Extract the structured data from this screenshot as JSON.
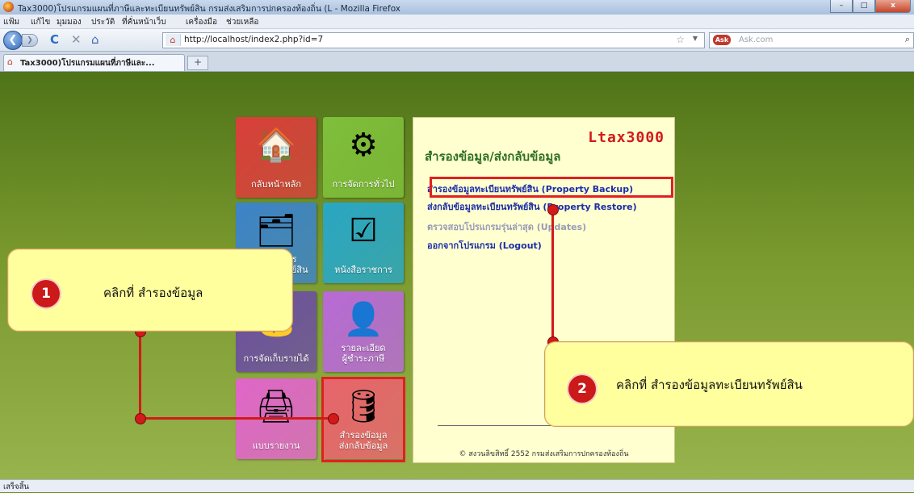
{
  "window": {
    "title": "Tax3000)โปรแกรมแผนที่ภาษีและทะเบียนทรัพย์สิน กรมส่งเสริมการปกครองท้องถิ่น (L - Mozilla Firefox",
    "minimize": "–",
    "maximize": "□",
    "close": "x"
  },
  "menubar": [
    "แฟ้ม",
    "แก้ไข",
    "มุมมอง",
    "ประวัติ",
    "ที่คั่นหน้าเว็บ",
    "เครื่องมือ",
    "ช่วยเหลือ"
  ],
  "nav": {
    "url": "http://localhost/index2.php?id=7",
    "search_placeholder": "Ask.com",
    "search_engine": "Ask",
    "reload": "C",
    "stop": "✕",
    "home": "⌂"
  },
  "tabs": [
    {
      "label": "Tax3000)โปรแกรมแผนที่ภาษีและ..."
    }
  ],
  "new_tab": "+",
  "tiles": [
    {
      "label": "กลับหน้าหลัก",
      "icon": "house-icon",
      "glyph": "🏠",
      "color": "#d9403a"
    },
    {
      "label": "การจัดการทั่วไป",
      "icon": "gear-pencil-icon",
      "glyph": "⚙",
      "color": "#7fbf3a"
    },
    {
      "label": "การจัดการ\nทะเบียนทรัพย์สิน",
      "icon": "folders-icon",
      "glyph": "🗂",
      "color": "#3d84c8"
    },
    {
      "label": "หนังสือราชการ",
      "icon": "checklist-icon",
      "glyph": "☑",
      "color": "#2aa7c4"
    },
    {
      "label": "การจัดเก็บรายได้",
      "icon": "money-icon",
      "glyph": "💰",
      "color": "#6c4fa0"
    },
    {
      "label": "รายละเอียด\nผู้ชำระภาษี",
      "icon": "user-search-icon",
      "glyph": "👤",
      "color": "#b86ad6"
    },
    {
      "label": "แบบรายงาน",
      "icon": "printer-icon",
      "glyph": "🖨",
      "color": "#e066c8"
    },
    {
      "label": "สำรองข้อมูล\nส่งกลับข้อมูล",
      "icon": "database-add-icon",
      "glyph": "🛢",
      "color": "#e8646c"
    }
  ],
  "panel": {
    "logo": "Ltax3000",
    "heading": "สำรองข้อมูล/ส่งกลับข้อมูล",
    "links": [
      {
        "label": "สำรองข้อมูลทะเบียนทรัพย์สิน (Property Backup)",
        "color": "#1b2ea8"
      },
      {
        "label": "ส่งกลับข้อมูลทะเบียนทรัพย์สิน (Property Restore)",
        "color": "#1b2ea8"
      },
      {
        "label": "ตรวจสอบโปรแกรมรุ่นล่าสุด (Updates)",
        "color": "#9a9ab8"
      },
      {
        "label": "ออกจากโปรแกรม (Logout)",
        "color": "#1b2ea8"
      }
    ],
    "footer": "© สงวนลิขสิทธิ์ 2552 กรมส่งเสริมการปกครองท้องถิ่น"
  },
  "callouts": [
    {
      "number": "1",
      "text": "คลิกที่  สำรองข้อมูล"
    },
    {
      "number": "2",
      "text": "คลิกที่   สำรองข้อมูลทะเบียนทรัพย์สิน"
    }
  ],
  "statusbar": {
    "text": "เสร็จสิ้น"
  },
  "colors": {
    "highlight": "#e02020",
    "callout_bg": "#ffff9e",
    "page_bg": "#6a8a22"
  }
}
